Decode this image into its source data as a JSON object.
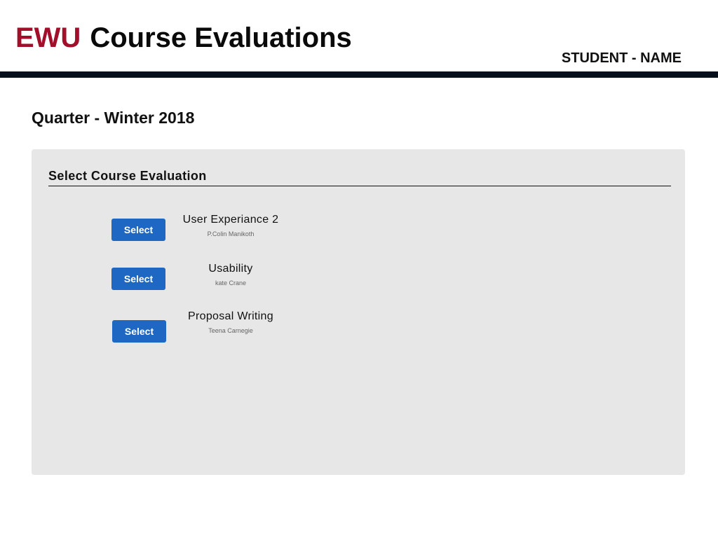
{
  "header": {
    "brand_mark": "EWU",
    "title": "Course Evaluations",
    "student_label": "STUDENT - NAME",
    "brand_color": "#a10f2b",
    "bar_color": "#06101c"
  },
  "page": {
    "quarter": "Quarter - Winter 2018"
  },
  "panel": {
    "title": "Select Course Evaluation",
    "background": "#e7e7e7",
    "button_color": "#1e67c3",
    "courses": [
      {
        "button_label": "Select",
        "name": "User Experiance 2",
        "instructor": "P.Colin Manikoth"
      },
      {
        "button_label": "Select",
        "name": "Usability",
        "instructor": "kate Crane"
      },
      {
        "button_label": "Select",
        "name": "Proposal Writing",
        "instructor": "Teena Carnegie"
      }
    ]
  }
}
